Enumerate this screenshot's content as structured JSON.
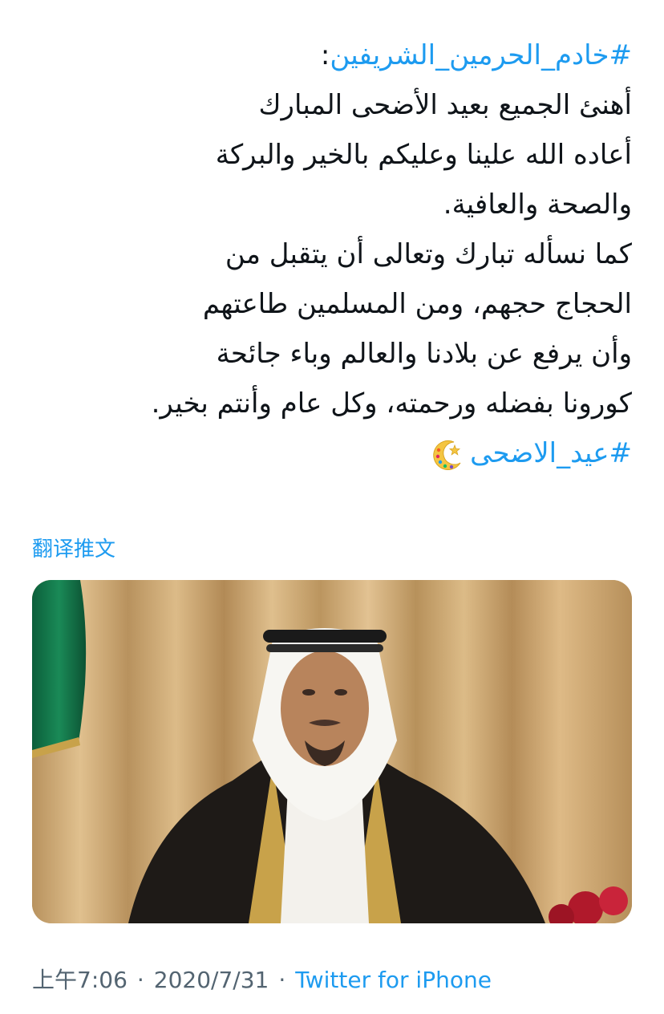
{
  "tweet": {
    "hashtag_author": "#خادم_الحرمين_الشريفين",
    "hashtag_author_suffix": ":",
    "lines": [
      "أهنئ الجميع بعيد الأضحى المبارك",
      "أعاده الله علينا وعليكم بالخير والبركة",
      "والصحة والعافية.",
      "كما نسأله تبارك وتعالى أن يتقبل من",
      "الحجاج حجهم، ومن المسلمين طاعتهم",
      "وأن يرفع عن بلادنا والعالم وباء جائحة",
      "كورونا بفضله ورحمته، وكل عام وأنتم بخير."
    ],
    "hashtag_eid": "#عيد_الاضحى",
    "emoji": "crescent-moon-star-icon"
  },
  "translate": {
    "label": "翻译推文"
  },
  "media": {
    "description_icon": "photo"
  },
  "meta": {
    "time": "上午7:06",
    "separator": "·",
    "date": "2020/7/31",
    "source": "Twitter for iPhone"
  },
  "colors": {
    "link": "#1d9bf0",
    "text": "#0f1419",
    "meta": "#536471"
  }
}
